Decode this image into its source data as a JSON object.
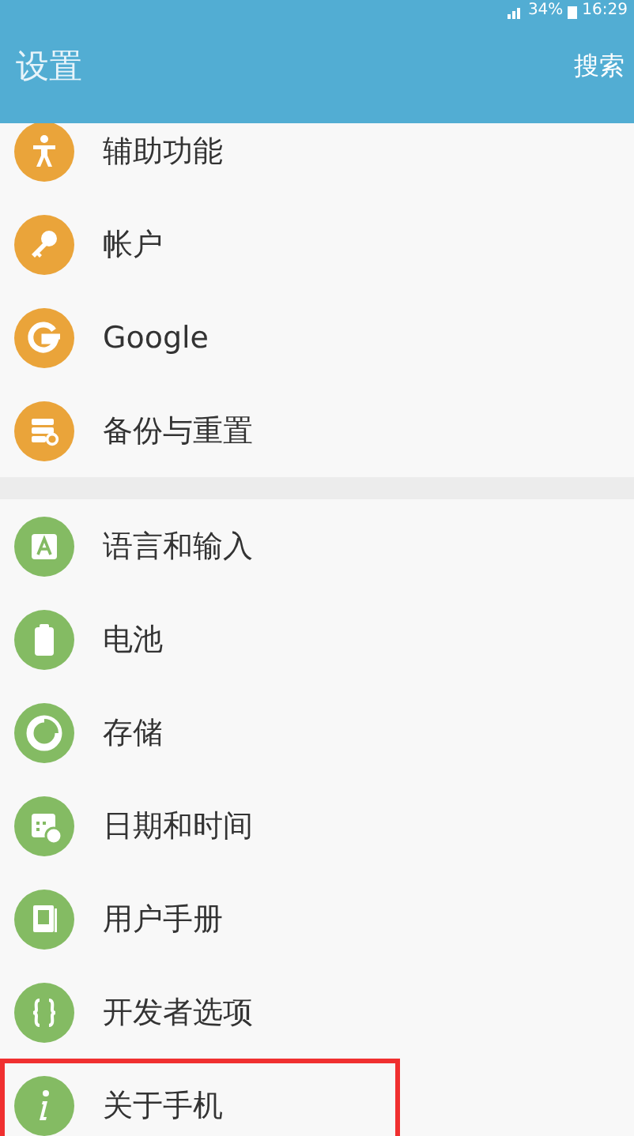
{
  "status_bar": {
    "battery": "34%",
    "time": "16:29"
  },
  "header": {
    "title": "设置",
    "action": "搜索"
  },
  "groups": [
    {
      "items": [
        {
          "label": "辅助功能",
          "color": "#eaa43a",
          "highlighted": false
        },
        {
          "label": "帐户",
          "color": "#eaa43a",
          "highlighted": false
        },
        {
          "label": "Google",
          "color": "#eaa43a",
          "highlighted": false
        },
        {
          "label": "备份与重置",
          "color": "#eaa43a",
          "highlighted": false
        }
      ]
    },
    {
      "items": [
        {
          "label": "语言和输入",
          "color": "#84bb63",
          "highlighted": false
        },
        {
          "label": "电池",
          "color": "#84bb63",
          "highlighted": false
        },
        {
          "label": "存储",
          "color": "#84bb63",
          "highlighted": false
        },
        {
          "label": "日期和时间",
          "color": "#84bb63",
          "highlighted": false
        },
        {
          "label": "用户手册",
          "color": "#84bb63",
          "highlighted": false
        },
        {
          "label": "开发者选项",
          "color": "#84bb63",
          "highlighted": false
        },
        {
          "label": "关于手机",
          "color": "#84bb63",
          "highlighted": true
        }
      ]
    }
  ]
}
